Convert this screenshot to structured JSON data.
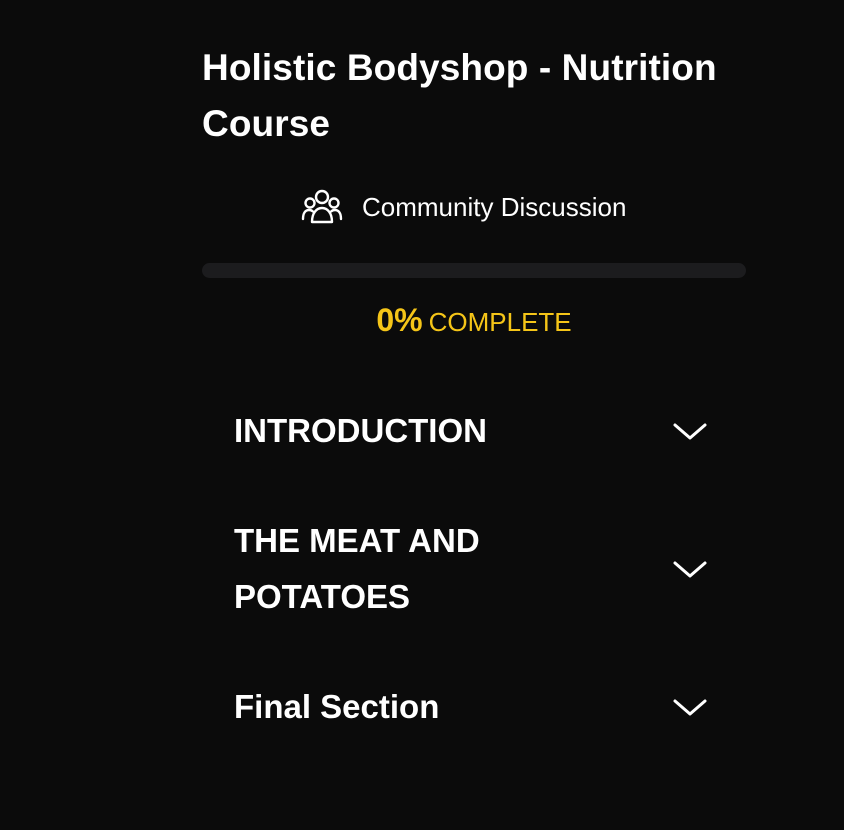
{
  "course": {
    "title": "Holistic Bodyshop - Nutrition Course"
  },
  "community": {
    "label": "Community Discussion",
    "icon": "users-group-icon"
  },
  "progress": {
    "percent": 0,
    "percent_label": "0%",
    "suffix": "COMPLETE",
    "accent_color": "#f5c518"
  },
  "sections": [
    {
      "label": "INTRODUCTION",
      "icon": "chevron-down-icon"
    },
    {
      "label": "THE MEAT AND POTATOES",
      "icon": "chevron-down-icon"
    },
    {
      "label": "Final Section",
      "icon": "chevron-down-icon"
    }
  ]
}
